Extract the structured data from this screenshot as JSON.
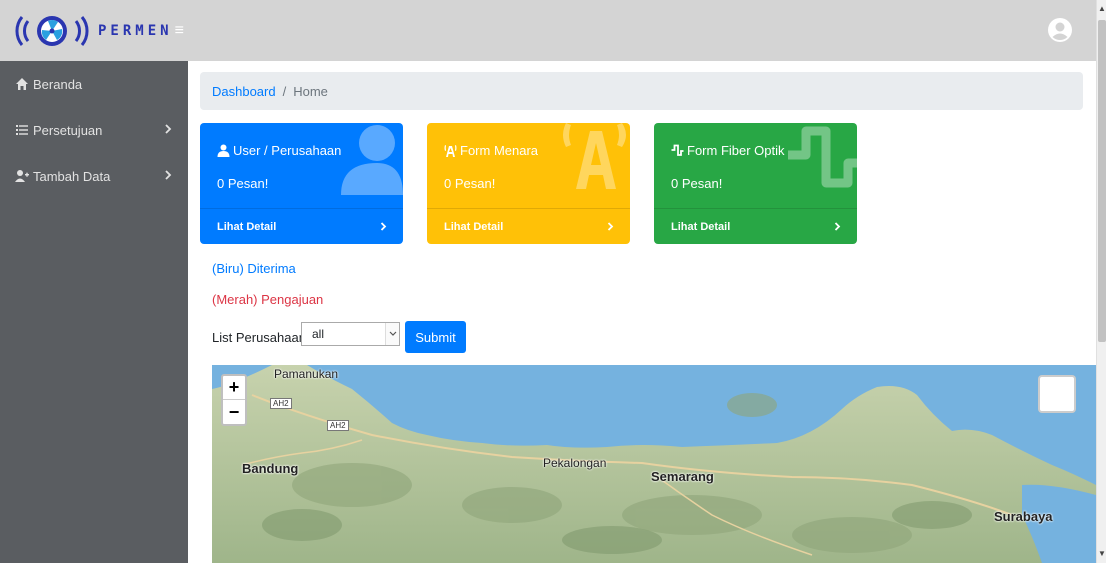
{
  "app": {
    "brand": "PERMEN",
    "hamburger_icon": "≡"
  },
  "sidebar": {
    "items": [
      {
        "label": "Beranda",
        "icon": "home-icon",
        "has_submenu": false
      },
      {
        "label": "Persetujuan",
        "icon": "list-icon",
        "has_submenu": true
      },
      {
        "label": "Tambah Data",
        "icon": "user-plus-icon",
        "has_submenu": true
      }
    ]
  },
  "breadcrumb": {
    "link": "Dashboard",
    "separator": "/",
    "current": "Home"
  },
  "cards": [
    {
      "title": "User / Perusahaan",
      "message": "0 Pesan!",
      "footer": "Lihat Detail",
      "color": "#007bff"
    },
    {
      "title": "Form Menara",
      "message": "0 Pesan!",
      "footer": "Lihat Detail",
      "color": "#ffc107"
    },
    {
      "title": "Form Fiber Optik",
      "message": "0 Pesan!",
      "footer": "Lihat Detail",
      "color": "#28a745"
    }
  ],
  "legend": {
    "blue": "(Biru) Diterima",
    "red": "(Merah) Pengajuan"
  },
  "filter": {
    "label": "List Perusahaan:",
    "selected": "all",
    "submit": "Submit"
  },
  "map": {
    "zoom_in": "+",
    "zoom_out": "−",
    "labels": {
      "pamanukan": "Pamanukan",
      "bandung": "Bandung",
      "pekalongan": "Pekalongan",
      "semarang": "Semarang",
      "surabaya": "Surabaya",
      "ah2_a": "AH2",
      "ah2_b": "AH2"
    }
  },
  "colors": {
    "sidebar": "#5a5d61",
    "topbar": "#d4d4d4",
    "primary": "#007bff",
    "warning": "#ffc107",
    "success": "#28a745",
    "danger": "#dc3545"
  }
}
